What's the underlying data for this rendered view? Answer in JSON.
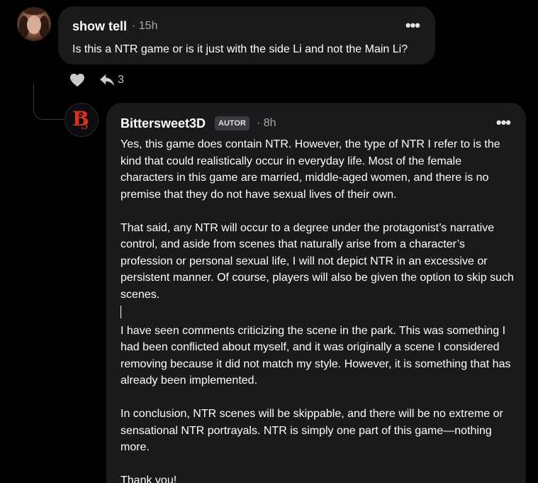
{
  "comment": {
    "author": "show tell",
    "time": "· 15h",
    "more": "•••",
    "text": "Is this a NTR game or is it just with the side Li and not the Main Li?",
    "reply_count": "3"
  },
  "reply": {
    "author": "Bittersweet3D",
    "badge": "AUTOR",
    "time": "· 8h",
    "more": "•••",
    "paragraphs": [
      "Yes, this game does contain NTR. However, the type of NTR I refer to is the kind that could realistically occur in everyday life. Most of the female characters in this game are married, middle-aged women, and there is no premise that they do not have sexual lives of their own.",
      "That said, any NTR will occur to a degree under the protagonist’s narrative control, and aside from scenes that naturally arise from a character’s profession or personal sexual life, I will not depict NTR in an excessive or persistent manner. Of course, players will also be given the option to skip such scenes.",
      "I have seen comments criticizing the scene in the park. This was something I had been conflicted about myself, and it was originally a scene I considered removing because it did not match my style. However, it is something that has already been implemented.",
      "In conclusion, NTR scenes will be skippable, and there will be no extreme or sensational NTR portrayals. NTR is simply one part of this game—nothing more.",
      "Thank you!"
    ]
  },
  "colors": {
    "background": "#000000",
    "bubble": "#1a191c",
    "muted_text": "#a8a8ac",
    "badge_bg": "#3a3a3f",
    "logo_red": "#d8341c"
  },
  "icons": [
    "heart-icon",
    "reply-icon",
    "more-icon"
  ]
}
